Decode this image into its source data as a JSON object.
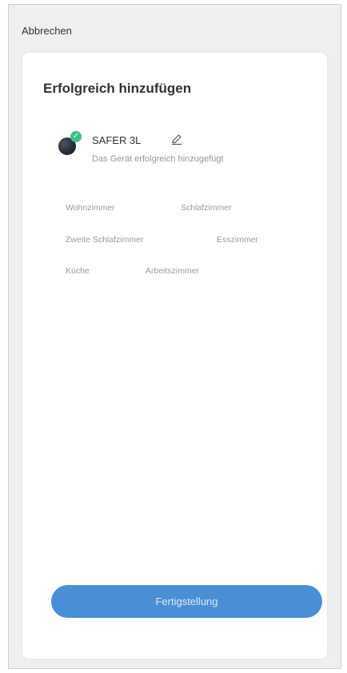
{
  "header": {
    "cancel_label": "Abbrechen"
  },
  "card": {
    "title": "Erfolgreich hinzufügen"
  },
  "device": {
    "name": "SAFER 3L",
    "status": "Das Gerät erfolgreich hinzugefügt",
    "icon": "device-ball-icon",
    "badge_icon": "check-icon",
    "badge_glyph": "✓",
    "badge_color": "#3cc08a"
  },
  "rooms": [
    {
      "label": "Wohnzimmer"
    },
    {
      "label": "Schlafzimmer"
    },
    {
      "label": "Zweite Schlafzimmer"
    },
    {
      "label": "Esszimmer"
    },
    {
      "label": "Küche"
    },
    {
      "label": "Arbeitszimmer"
    }
  ],
  "footer": {
    "finish_label": "Fertigstellung",
    "accent_color": "#4a8fd6"
  }
}
